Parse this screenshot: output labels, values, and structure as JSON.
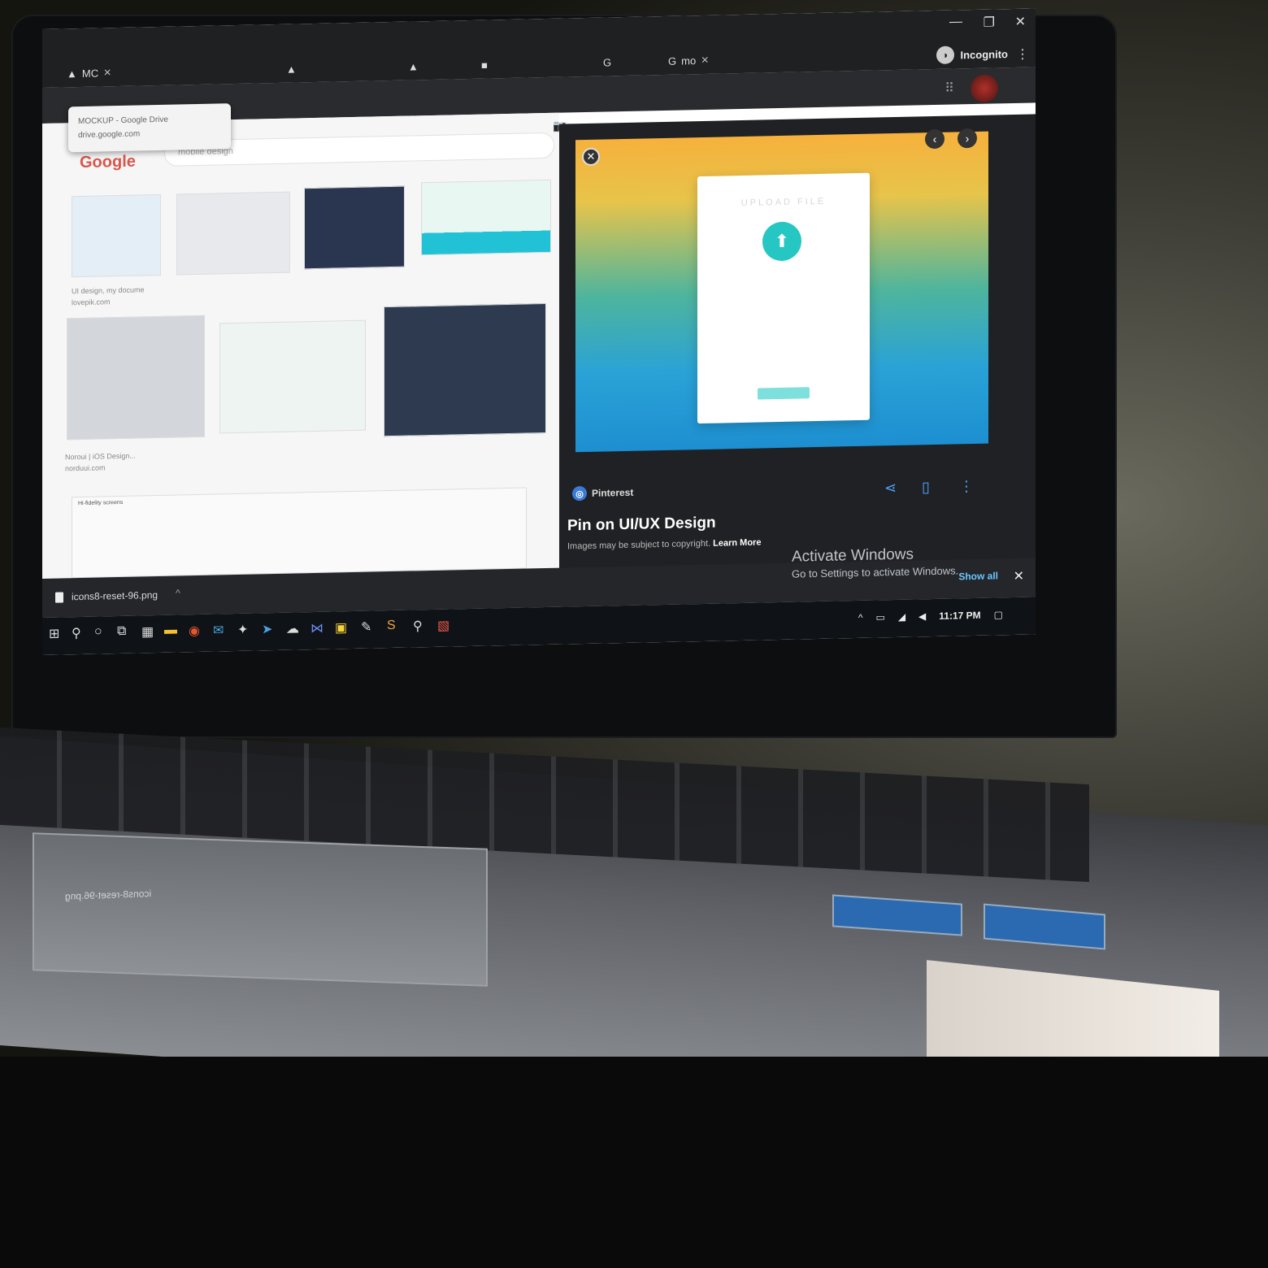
{
  "browser": {
    "tab_active": "MC",
    "tab2": "mo",
    "incognito_label": "Incognito",
    "tooltip_title": "MOCKUP - Google Drive",
    "tooltip_url": "drive.google.com"
  },
  "search": {
    "logo": "Google",
    "query": "mobile design"
  },
  "results": [
    {
      "caption": "UI design, my docume",
      "source": "lovepik.com"
    },
    {
      "caption": "Noroui | iOS Design...",
      "source": "norduui.com"
    },
    {
      "caption": "Hi-fidelity screens",
      "source": ""
    }
  ],
  "preview": {
    "card_title": "UPLOAD FILE",
    "source": "Pinterest",
    "title": "Pin on UI/UX Design",
    "copyright": "Images may be subject to copyright.",
    "learn_more": "Learn More"
  },
  "activation": {
    "line1": "Activate Windows",
    "line2": "Go to Settings to activate Windows."
  },
  "downloads": {
    "file": "icons8-reset-96.png",
    "show_all": "Show all"
  },
  "taskbar": {
    "time": "11:17 PM"
  }
}
